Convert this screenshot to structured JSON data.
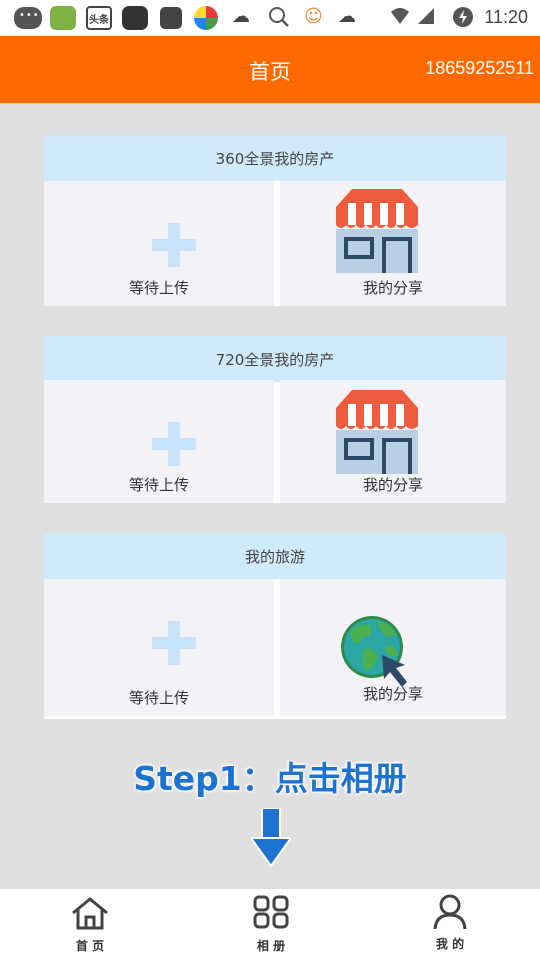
{
  "status_bar": {
    "app_badge": "头条",
    "time": "11:20",
    "icons": [
      "chat-icon",
      "weather-app-icon",
      "news-icon",
      "browser-icon",
      "app-icon",
      "chrome-icon",
      "cloud-icon",
      "search-icon",
      "face-icon",
      "cloud-icon",
      "wifi-icon",
      "signal-icon",
      "battery-icon"
    ]
  },
  "header": {
    "title": "首页",
    "phone": "18659252511"
  },
  "sections": [
    {
      "title": "360全景我的房产",
      "upload_label": "等待上传",
      "share_label": "我的分享",
      "share_icon": "storefront-icon"
    },
    {
      "title": "720全景我的房产",
      "upload_label": "等待上传",
      "share_label": "我的分享",
      "share_icon": "storefront-icon"
    },
    {
      "title": "我的旅游",
      "upload_label": "等待上传",
      "share_label": "我的分享",
      "share_icon": "globe-cursor-icon"
    }
  ],
  "overlay": {
    "step_text": "Step1：点击相册",
    "arrow": "down-arrow-icon"
  },
  "tabbar": {
    "tabs": [
      {
        "label": "首 页",
        "icon": "home-icon"
      },
      {
        "label": "相 册",
        "icon": "grid-icon"
      },
      {
        "label": "我 的",
        "icon": "person-icon"
      }
    ]
  },
  "colors": {
    "header_bg": "#ff6a00",
    "card_header_bg": "#cfeafb",
    "step_text": "#1e73d2",
    "page_bg": "#e0e0e0"
  }
}
